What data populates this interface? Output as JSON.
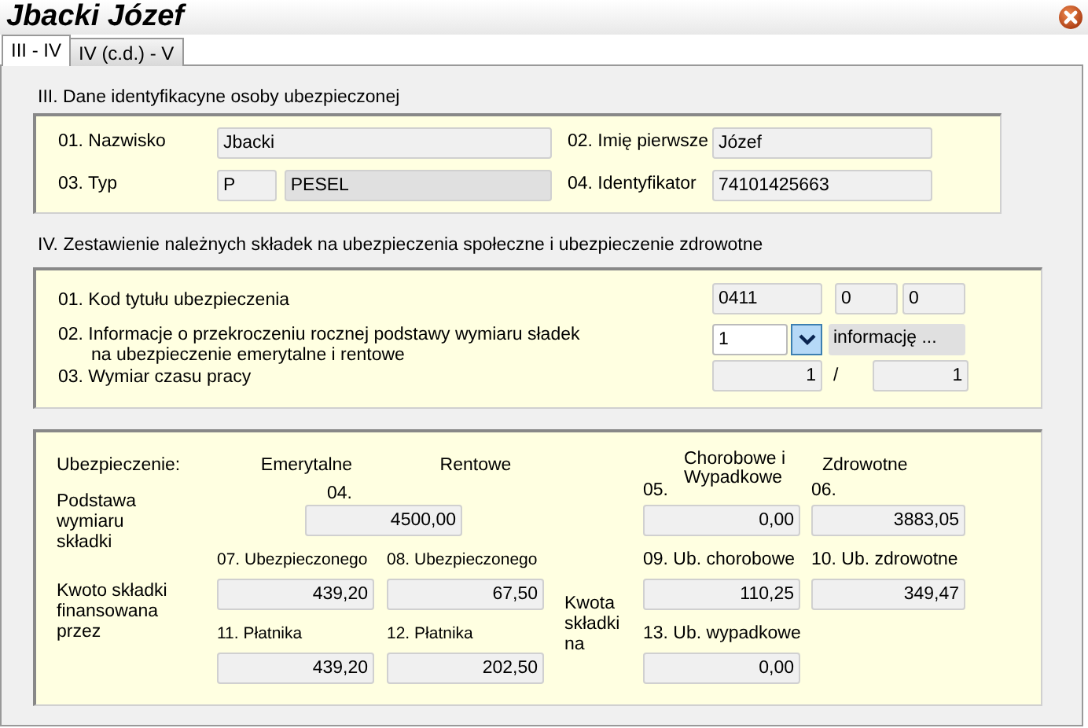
{
  "window": {
    "title": "Jbacki Józef"
  },
  "tabs": [
    {
      "label": "III - IV",
      "selected": true
    },
    {
      "label": "IV (c.d.) - V",
      "selected": false
    }
  ],
  "section_3": {
    "heading": "III. Dane identyfikacyne osoby ubezpieczonej",
    "fields": [
      {
        "label": "01. Nazwisko",
        "value": "Jbacki"
      },
      {
        "label": "02. Imię pierwsze",
        "value": "Józef"
      },
      {
        "label": "03. Typ",
        "value": "P",
        "description": "PESEL"
      },
      {
        "label": "04. Identyfikator",
        "value": "74101425663"
      }
    ]
  },
  "section_4": {
    "heading": "IV. Zestawienie należnych składek na ubezpieczenia społeczne i ubezpieczenie zdrowotne",
    "rows": [
      {
        "kind": "triple",
        "label": "01. Kod tytułu ubezpieczenia",
        "values": [
          "0411",
          "0",
          "0"
        ]
      },
      {
        "kind": "combo",
        "label": "02. Informacje o przekroczeniu rocznej podstawy wymiaru sładek na ubezpieczenie emerytalne i rentowe",
        "value": "1",
        "description": "informację ..."
      },
      {
        "kind": "ratio",
        "label": "03. Wymiar czasu pracy",
        "values": [
          "1",
          "1"
        ],
        "separator": "/"
      }
    ]
  },
  "contributions": {
    "label": "Ubezpieczenie:",
    "headers": [
      "Emerytalne",
      "Rentowe",
      "Chorobowe i Wypadkowe",
      "Zdrowotne"
    ],
    "base_label": "Podstawa wymiaru składki",
    "base_fields": [
      {
        "label": "04.",
        "value": "4500,00"
      },
      {
        "label": "05.",
        "value": "0,00"
      },
      {
        "label": "06.",
        "value": "3883,05"
      }
    ],
    "financed_label": "Kwoto składki finansowana przez",
    "financed_fields": [
      {
        "label": "07. Ubezpieczonego",
        "value": "439,20"
      },
      {
        "label": "08. Ubezpieczonego",
        "value": "67,50"
      },
      {
        "label": "11. Płatnika",
        "value": "439,20"
      },
      {
        "label": "12. Płatnika",
        "value": "202,50"
      }
    ],
    "amount_label": "Kwota składki na",
    "amount_fields": [
      {
        "label": "09. Ub. chorobowe",
        "value": "110,25"
      },
      {
        "label": "10. Ub. zdrowotne",
        "value": "349,47"
      },
      {
        "label": "13. Ub. wypadkowe",
        "value": "0,00"
      }
    ]
  }
}
